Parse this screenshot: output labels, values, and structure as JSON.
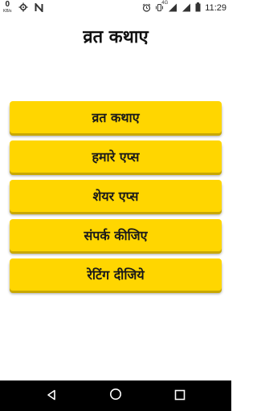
{
  "status_bar": {
    "speed_value": "0",
    "speed_unit": "KB/s",
    "network_label": "4G",
    "clock": "11:29",
    "icons": [
      "settings-notification-icon",
      "notification-n-icon",
      "alarm-icon",
      "vibrate-icon",
      "signal-icon",
      "signal-icon-2",
      "battery-icon"
    ]
  },
  "app": {
    "title": "व्रत कथाए"
  },
  "menu": {
    "items": [
      {
        "label": "व्रत कथाए"
      },
      {
        "label": "हमारे एप्स"
      },
      {
        "label": "शेयर एप्स"
      },
      {
        "label": "संपर्क कीजिए"
      },
      {
        "label": "रेटिंग दीजिये"
      }
    ]
  },
  "nav_bar": {
    "icons": [
      "back-icon",
      "home-icon",
      "recents-icon"
    ]
  },
  "colors": {
    "button_background": "#ffd600",
    "button_shadow": "#c9a800",
    "nav_bar": "#000000"
  }
}
